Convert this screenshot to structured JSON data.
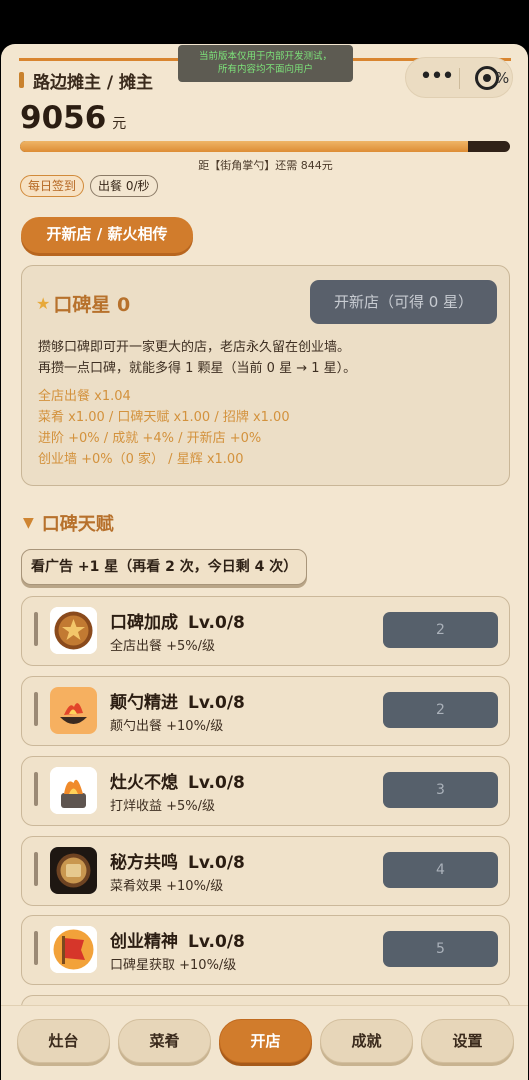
{
  "dev_banner": {
    "line1": "当前版本仅用于内部开发测试，",
    "line2": "所有内容均不面向用户"
  },
  "capsule": {
    "more_icon": "more-dots-icon",
    "close_icon": "target-icon",
    "partial_text": "%"
  },
  "header": {
    "rank_title": "路边摊主 / 摊主",
    "money_value": "9056",
    "money_unit": "元",
    "progress_fraction": 0.915,
    "progress_text": "距【街角掌勺】还需 844元",
    "sign_in_label": "每日签到",
    "serve_rate_label": "出餐 0/秒"
  },
  "section_tab": {
    "label": "开新店 / 薪火相传"
  },
  "reputation_panel": {
    "star_icon": "star-icon",
    "title": "口碑星 0",
    "new_store_button": "开新店（可得 0 星）",
    "desc_line1": "攒够口碑即可开一家更大的店，老店永久留在创业墙。",
    "desc_line2": "再攒一点口碑，就能多得 1 颗星（当前 0 星 → 1 星）。",
    "mult_line1": "全店出餐 x1.04",
    "mult_line2": "菜肴 x1.00 / 口碑天赋 x1.00 / 招牌 x1.00",
    "mult_line3": "进阶 +0% / 成就 +4% / 开新店 +0%",
    "mult_line4": "创业墙 +0%（0 家） / 星辉 x1.00"
  },
  "talents": {
    "heading": "口碑天赋",
    "ad_button": "看广告 +1 星（再看 2 次，今日剩 4 次）",
    "items": [
      {
        "name": "口碑加成",
        "level": "Lv.0/8",
        "desc": "全店出餐 +5%/级",
        "cost": "2",
        "icon": "star-medal-icon"
      },
      {
        "name": "颠勺精进",
        "level": "Lv.0/8",
        "desc": "颠勺出餐 +10%/级",
        "cost": "2",
        "icon": "wok-flame-icon"
      },
      {
        "name": "灶火不熄",
        "level": "Lv.0/8",
        "desc": "打烊收益 +5%/级",
        "cost": "3",
        "icon": "stove-fire-icon"
      },
      {
        "name": "秘方共鸣",
        "level": "Lv.0/8",
        "desc": "菜肴效果 +10%/级",
        "cost": "4",
        "icon": "recipe-scroll-icon"
      },
      {
        "name": "创业精神",
        "level": "Lv.0/8",
        "desc": "口碑星获取 +10%/级",
        "cost": "5",
        "icon": "banner-flag-icon"
      }
    ]
  },
  "bottom_nav": {
    "items": [
      {
        "label": "灶台"
      },
      {
        "label": "菜肴"
      },
      {
        "label": "开店"
      },
      {
        "label": "成就"
      },
      {
        "label": "设置"
      }
    ],
    "active": "开店"
  },
  "colors": {
    "background": "#f3e6d0",
    "accent_orange": "#d17c2c",
    "disabled_button": "#56606b",
    "gold_text": "#b7712c"
  }
}
